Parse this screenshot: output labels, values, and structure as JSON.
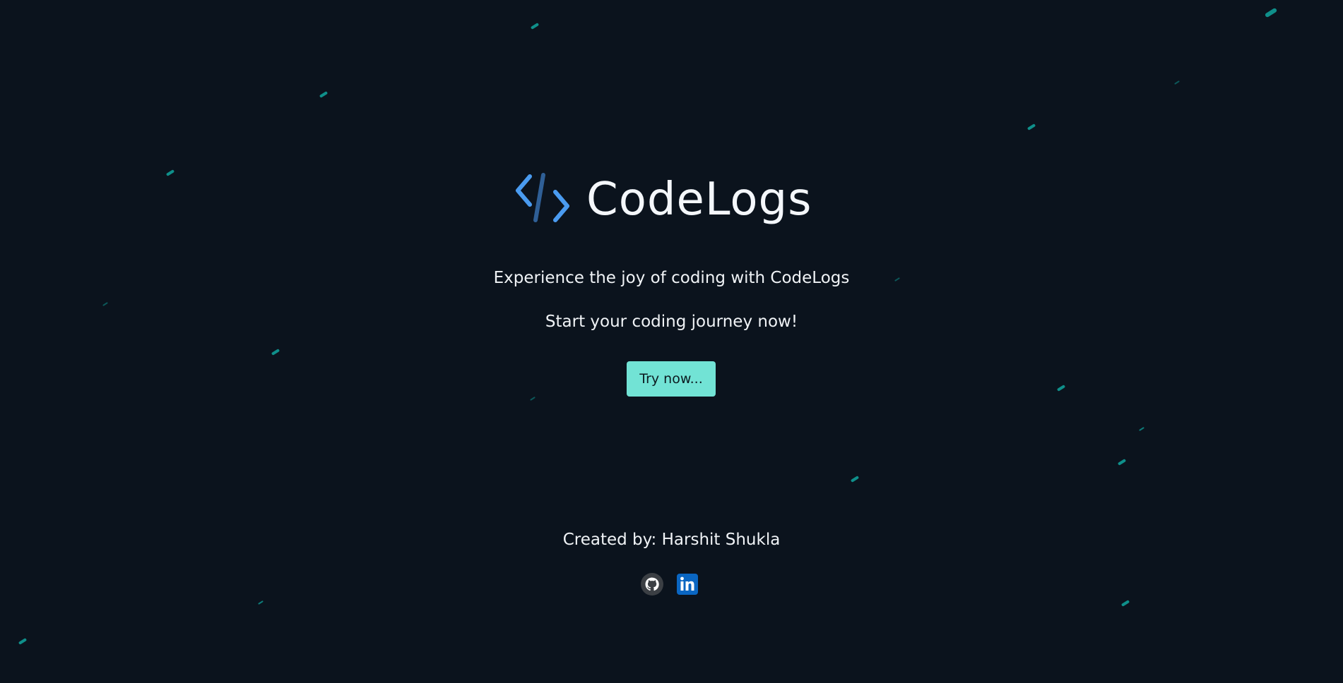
{
  "brand": {
    "name": "CodeLogs",
    "logo_icon": "code-brackets-icon",
    "logo_color": "#4a9bf0"
  },
  "hero": {
    "tagline": "Experience the joy of coding with CodeLogs",
    "subtagline": "Start your coding journey now!",
    "cta_label": "Try now..."
  },
  "footer": {
    "credit": "Created by: Harshit Shukla",
    "socials": [
      {
        "icon": "github-icon",
        "name": "GitHub"
      },
      {
        "icon": "linkedin-icon",
        "name": "LinkedIn"
      }
    ]
  },
  "colors": {
    "background": "#0b131d",
    "accent": "#72e3d5",
    "streak": "#0f8f8a",
    "text": "#f0f3f6",
    "linkedin": "#0a66c2"
  }
}
